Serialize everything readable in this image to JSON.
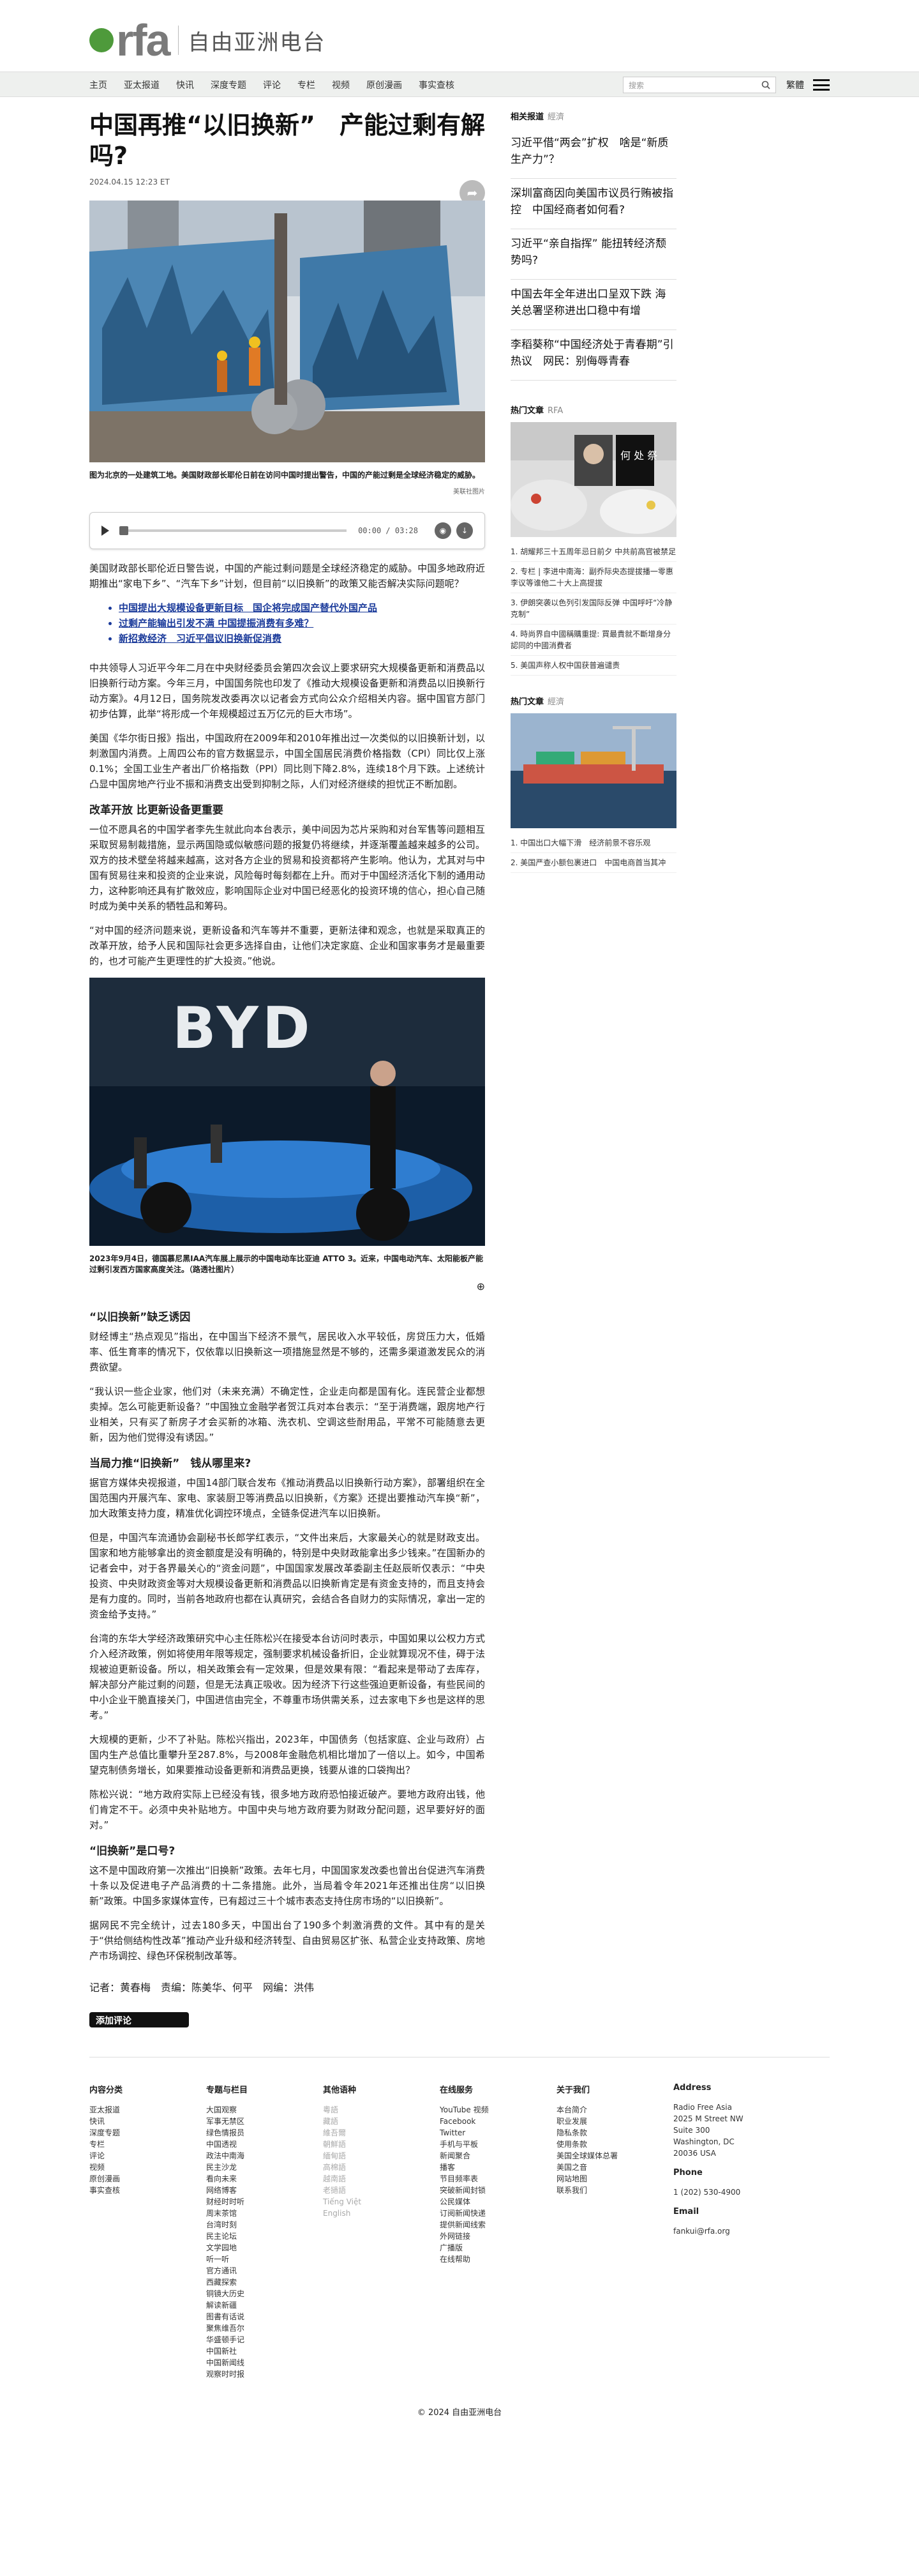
{
  "header": {
    "logo_text": "rfa",
    "site_name": "自由亚洲电台"
  },
  "nav": {
    "items": [
      "主页",
      "亚太报道",
      "快讯",
      "深度专题",
      "评论",
      "专栏",
      "视频",
      "原创漫画",
      "事实查核"
    ],
    "search_placeholder": "搜索",
    "lang": "繁體"
  },
  "article": {
    "title": "中国再推“以旧换新”　产能过剩有解吗?",
    "date": "2024.04.15 12:23 ET",
    "hero_caption": "图为北京的一处建筑工地。美国财政部长耶伦日前在访问中国时提出警告，中国的产能过剩是全球经济稳定的威胁。",
    "hero_source": "美联社图片",
    "audio_time": "00:00 / 03:28",
    "paragraphs_1": [
      "美国财政部长耶伦近日警告说，中国的产能过剩问题是全球经济稳定的威胁。中国多地政府近期推出“家电下乡”、“汽车下乡”计划，但目前“以旧换新”的政策又能否解决实际问题呢？"
    ],
    "links": [
      "中国提出大规模设备更新目标　国企将完成国产替代外国产品",
      "过剩产能输出引发不满 中国提振消费有多难？",
      "新招救经济　习近平倡议旧换新促消费"
    ],
    "paragraphs_2": [
      "中共领导人习近平今年二月在中央财经委员会第四次会议上要求研究大规模备更新和消费品以旧换新行动方案。今年三月，中国国务院也印发了《推动大规模设备更新和消费品以旧换新行动方案》。4月12日，国务院发改委再次以记者会方式向公众介绍相关内容。据中国官方部门初步估算，此举“将形成一个年规模超过五万亿元的巨大市场”。",
      "美国《华尔街日报》指出，中国政府在2009年和2010年推出过一次类似的以旧换新计划，以刺激国内消费。上周四公布的官方数据显示，中国全国居民消费价格指数（CPI）同比仅上涨0.1%；全国工业生产者出厂价格指数（PPI）同比则下降2.8%，连续18个月下跌。上述统计凸显中国房地产行业不振和消费支出受到抑制之际，人们对经济继续的担忧正不断加剧。"
    ],
    "h_1": "改革开放 比更新设备更重要",
    "paragraphs_3": [
      "一位不愿具名的中国学者李先生就此向本台表示，美中间因为芯片采购和对台军售等问题相互采取贸易制裁措施，显示两国隐或似敏感问题的报复仍将继续，并逐渐覆盖越来越多的公司。双方的技术壁垒将越来越高，这对各方企业的贸易和投资都将产生影响。他认为，尤其对与中国有贸易往来和投资的企业来说，风险每时每刻都在上升。而对于中国经济活化下制的通用动力，这种影响还具有扩散效应，影响国际企业对中国已经恶化的投资环境的信心，担心自己随时成为美中关系的牺牲品和筹码。",
      "“对中国的经济问题来说，更新设备和汽车等并不重要，更新法律和观念，也就是采取真正的改革开放，给予人民和国际社会更多选择自由，让他们决定家庭、企业和国家事务才是最重要的，也才可能产生更理性的扩大投资。”他说。"
    ],
    "img2_caption": "2023年9月4日，德国慕尼黑IAA汽车展上展示的中国电动车比亚迪 ATTO 3。近来，中国电动汽车、太阳能板产能过剩引发西方国家高度关注。（路透社图片）",
    "img2_logo": "BYD",
    "h_2": "“以旧换新”缺乏诱因",
    "paragraphs_4": [
      "财经博主“热点观见”指出，在中国当下经济不景气，居民收入水平较低，房贷压力大，低婚率、低生育率的情况下，仅依靠以旧换新这一项措施显然是不够的，还需多渠道激发民众的消费欲望。",
      "“我认识一些企业家，他们对（未来充满）不确定性，企业走向都是国有化。连民营企业都想卖掉。怎么可能更新设备？”中国独立金融学者贺江兵对本台表示：“至于消费端，跟房地产行业相关，只有买了新房子才会买新的冰箱、洗衣机、空调这些耐用品，平常不可能随意去更新，因为他们觉得没有诱因。”"
    ],
    "h_3": "当局力推“旧换新”　钱从哪里来?",
    "paragraphs_5": [
      "据官方媒体央视报道，中国14部门联合发布《推动消费品以旧换新行动方案》，部署组织在全国范围内开展汽车、家电、家装厨卫等消费品以旧换新，《方案》还提出要推动汽车换“新”，加大政策支持力度，精准优化调控环境点，全链条促进汽车以旧换新。",
      "但是，中国汽车流通协会副秘书长郎学红表示，“文件出来后，大家最关心的就是财政支出。国家和地方能够拿出的资金额度是没有明确的，特别是中央财政能拿出多少钱来。”在国新办的记者会中，对于各界最关心的“资金问题”，中国国家发展改革委副主任赵辰昕仅表示：“中央投资、中央财政资金等对大规模设备更新和消费品以旧换新肯定是有资金支持的，而且支持会是有力度的。同时，当前各地政府也都在认真研究，会结合各自财力的实际情况，拿出一定的资金给予支持。”",
      "台湾的东华大学经济政策研究中心主任陈松兴在接受本台访问时表示，中国如果以公权力方式介入经济政策，例如将使用年限等规定，强制要求机械设备折旧，企业就算现况不佳，碍于法规被迫更新设备。所以，相关政策会有一定效果，但是效果有限：“看起来是带动了去库存，解决部分产能过剩的问题，但是无法真正吸收。因为经济下行这些强迫更新设备，有些民间的中小企业干脆直接关门，中国进信由完全，不尊重市场供需关系，过去家电下乡也是这样的思考。”",
      "大规模的更新，少不了补贴。陈松兴指出，2023年，中国债务（包括家庭、企业与政府）占国内生产总值比重攀升至287.8%，与2008年金融危机相比增加了一倍以上。如今，中国希望克制债务增长，如果要推动设备更新和消费品更换，钱要从谁的口袋掏出？",
      "陈松兴说：“地方政府实际上已经没有钱，很多地方政府恐怕接近破产。要地方政府出钱，他们肯定不干。必须中央补贴地方。中国中央与地方政府要为财政分配问题，迟早要好好的面对。”"
    ],
    "h_4": "“旧换新”是口号?",
    "paragraphs_6": [
      "这不是中国政府第一次推出“旧换新”政策。去年七月，中国国家发改委也曾出台促进汽车消费十条以及促进电子产品消费的十二条措施。此外，当局着令年2021年还推出住房“以旧换新”政策。中国多家媒体宣传，已有超过三十个城市表态支持住房市场的“以旧换新”。",
      "据网民不完全统计，过去180多天，中国出台了190多个刺激消费的文件。其中有的是关于“供给侧结构性改革”推动产业升级和经济转型、自由贸易区扩张、私营企业支持政策、房地产市场调控、绿色环保税制改革等。"
    ],
    "byline": "记者：黄春梅　责编：陈美华、何平　网编：洪伟",
    "comment_button": "添加评论"
  },
  "sidebar": {
    "related_heading": "相关报道",
    "related_tag": "經濟",
    "related": [
      "习近平借“两会”扩权　啥是“新质生产力”？",
      "深圳富商因向美国市议员行贿被指控　中国经商者如何看?",
      "习近平“亲自指挥” 能扭转经济颓势吗?",
      "中国去年全年进出口呈双下跌 海关总署坚称进出口稳中有增",
      "李稻葵称“中国经济处于青春期”引热议　网民：别侮辱青春"
    ],
    "hot_heading": "热门文章",
    "hot_tag": "RFA",
    "hot_img_text": "何 处 祭",
    "hot": [
      "1. 胡耀邦三十五周年忌日前夕 中共前高官被禁足",
      "2. 专栏 | 李进中南海：副乔际央态提拔播一零惠李议等谁他二十大上高提拔",
      "3. 伊朗突袭以色列引发国际反弹 中国呼吁“冷静克制”",
      "4. 時尚界自中國稱購重提: 買最貴就不斷增身分認同的中國消費者",
      "5. 美国声称人权中国获普遍谴责"
    ],
    "hot2_heading": "热门文章",
    "hot2_tag": "經濟",
    "hot2": [
      "1. 中国出口大幅下滑　经济前景不容乐观",
      "2. 美国严查小额包裹进口　中国电商首当其冲"
    ]
  },
  "footer": {
    "cols": [
      {
        "title": "内容分类",
        "items": [
          "亚太报道",
          "快讯",
          "深度专题",
          "专栏",
          "评论",
          "视频",
          "原创漫画",
          "事实查核"
        ]
      },
      {
        "title": "专题与栏目",
        "items": [
          "大国观察",
          "军事无禁区",
          "绿色情报员",
          "中国透视",
          "政法中南海",
          "民主沙龙",
          "看向未来",
          "网络博客",
          "财经时时听",
          "周末茶馆",
          "台湾时刻",
          "民主论坛",
          "文学园地",
          "听一听",
          "官方通讯",
          "西藏探索",
          "铜镜大历史",
          "解读新疆",
          "图書有话说",
          "聚焦维吾尔",
          "华盛顿手记",
          "中国新社",
          "中国新闻线",
          "观察时时报"
        ]
      },
      {
        "title": "其他语种",
        "items": [
          "粵語",
          "藏語",
          "維吾爾",
          "朝鮮語",
          "緬甸語",
          "高棉語",
          "越南語",
          "老撾語",
          "Tiếng Việt",
          "English"
        ]
      },
      {
        "title": "在线服务",
        "items": [
          "YouTube 视频",
          "Facebook",
          "Twitter",
          "手机与平板",
          "新闻聚合",
          "播客",
          "节目频率表",
          "突破新闻封锁",
          "公民媒体",
          "订阅新闻快递",
          "提供新闻线索",
          "外网链接",
          "广播版",
          "在线帮助"
        ]
      },
      {
        "title": "关于我们",
        "items": [
          "本台简介",
          "职业发展",
          "隐私条款",
          "使用条款",
          "美国全球媒体总署",
          "美国之音",
          "网站地图",
          "联系我们"
        ]
      }
    ],
    "address_title": "Address",
    "address": [
      "Radio Free Asia",
      "2025 M Street NW",
      "Suite 300",
      "Washington, DC",
      "20036 USA"
    ],
    "phone_title": "Phone",
    "phone": "1 (202) 530-4900",
    "email_title": "Email",
    "email": "fankui@rfa.org",
    "copyright": "© 2024 自由亚洲电台"
  }
}
